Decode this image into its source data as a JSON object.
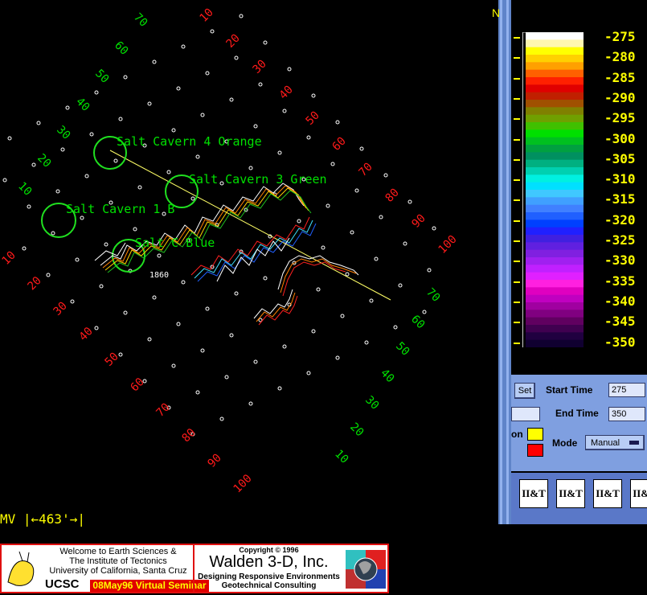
{
  "window": {
    "title_glyph": "N"
  },
  "map": {
    "cavern_labels": {
      "orange": "Salt Cavern 4 Orange",
      "green": "Salt Cavern 3 Green",
      "black": "Salt Cavern 1 B",
      "blue": "Salt C   Blue"
    },
    "marker": "1860",
    "left_axis_top": [
      "70",
      "60",
      "50",
      "40",
      "30",
      "20",
      "10"
    ],
    "right_axis_top": [
      "10",
      "20",
      "30",
      "40",
      "50",
      "60",
      "70",
      "80",
      "90",
      "100"
    ],
    "left_axis_bottom": [
      "10",
      "20",
      "30",
      "40",
      "50",
      "60",
      "70",
      "80",
      "90",
      "100"
    ],
    "right_axis_bottom": [
      "70",
      "60",
      "50",
      "40",
      "30",
      "20",
      "10"
    ],
    "colors": {
      "green_labels": "#00e000",
      "red_labels": "#ff1a1a",
      "dots": "#ffffff",
      "profile_line": "#ffff66"
    }
  },
  "scale": {
    "text": "MV |←463'→|"
  },
  "legend": {
    "ticks": [
      "-275",
      "-280",
      "-285",
      "-290",
      "-295",
      "-300",
      "-305",
      "-310",
      "-315",
      "-320",
      "-325",
      "-330",
      "-335",
      "-340",
      "-345",
      "-350"
    ],
    "colors": [
      "#ffffff",
      "#fff7b0",
      "#ffff00",
      "#ffd000",
      "#ffa000",
      "#ff6000",
      "#ff2000",
      "#e00000",
      "#c02000",
      "#a05000",
      "#808000",
      "#70a000",
      "#40c000",
      "#00e000",
      "#00c020",
      "#00a040",
      "#009060",
      "#00b080",
      "#00d0b0",
      "#00f0e0",
      "#00e0ff",
      "#40c8ff",
      "#40a0ff",
      "#4080ff",
      "#2060ff",
      "#0040ff",
      "#2020ff",
      "#4020e0",
      "#6020e0",
      "#8020e0",
      "#a020f0",
      "#c020ff",
      "#e020ff",
      "#ff20e0",
      "#e000c0",
      "#c000c0",
      "#a000a0",
      "#800080",
      "#600060",
      "#400050",
      "#200040",
      "#100030"
    ]
  },
  "controls": {
    "set_label": "Set",
    "start_time_label": "Start Time",
    "start_time_value": "275",
    "end_time_label": "End Time",
    "end_time_value": "350",
    "partial_label": "on",
    "mode_label": "Mode",
    "mode_value": "Manual",
    "swatch_yellow": "#ffff00",
    "swatch_red": "#ff0000"
  },
  "icons": [
    "II&T",
    "II&T",
    "II&T",
    "II&T"
  ],
  "banner": {
    "welcome_line1": "Welcome to Earth Sciences &",
    "welcome_line2": "The Institute of Tectonics",
    "welcome_line3": "University of California, Santa Cruz",
    "ucsc": "UCSC",
    "seminar": "08May96 Virtual Seminar",
    "copyright": "Copyright © 1996",
    "company": "Walden 3-D, Inc.",
    "tagline1": "Designing Responsive Environments",
    "tagline2": "Geotechnical Consulting"
  }
}
